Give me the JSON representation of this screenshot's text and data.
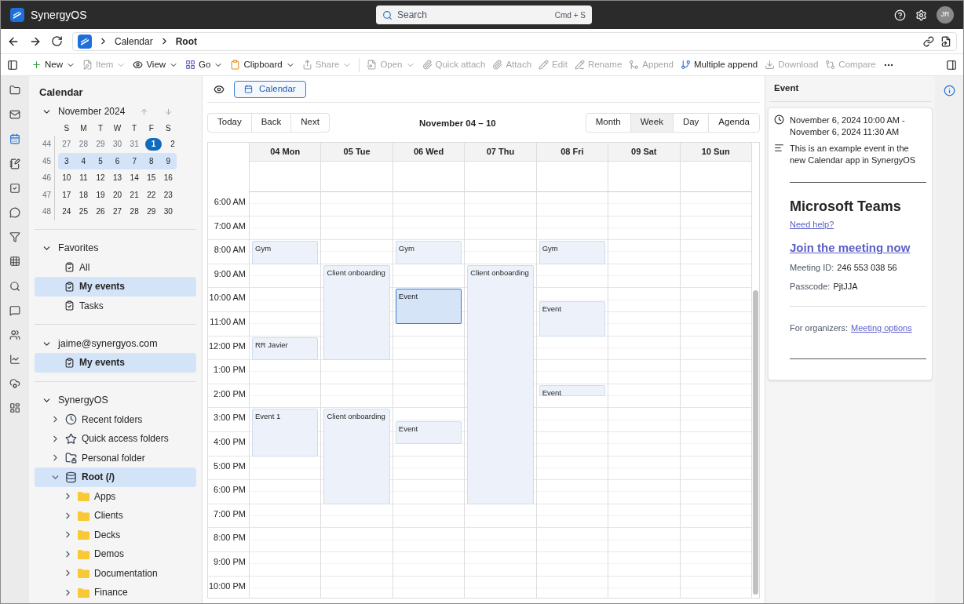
{
  "app": {
    "name": "SynergyOS",
    "search": {
      "placeholder": "Search",
      "shortcut": "Cmd + S"
    },
    "avatar": "JR"
  },
  "breadcrumb": [
    {
      "label": "Calendar",
      "current": false
    },
    {
      "label": "Root",
      "current": true
    }
  ],
  "toolbar": [
    {
      "label": "New",
      "disabled": false,
      "dropdown": true
    },
    {
      "label": "Item",
      "disabled": true,
      "dropdown": true
    },
    {
      "label": "View",
      "disabled": false,
      "dropdown": true
    },
    {
      "label": "Go",
      "disabled": false,
      "dropdown": true
    },
    {
      "label": "Clipboard",
      "disabled": false,
      "dropdown": true
    },
    {
      "label": "Share",
      "disabled": true,
      "dropdown": true
    },
    {
      "label": "Open",
      "disabled": true,
      "dropdown": true
    },
    {
      "label": "Quick attach",
      "disabled": true,
      "dropdown": false
    },
    {
      "label": "Attach",
      "disabled": true,
      "dropdown": false
    },
    {
      "label": "Edit",
      "disabled": true,
      "dropdown": false
    },
    {
      "label": "Rename",
      "disabled": true,
      "dropdown": false
    },
    {
      "label": "Append",
      "disabled": true,
      "dropdown": false
    },
    {
      "label": "Multiple append",
      "disabled": false,
      "dropdown": false
    },
    {
      "label": "Download",
      "disabled": true,
      "dropdown": false
    },
    {
      "label": "Compare",
      "disabled": true,
      "dropdown": false
    }
  ],
  "nav_rail": [
    {
      "selected": false
    },
    {
      "selected": false
    },
    {
      "selected": true
    },
    {
      "selected": false
    },
    {
      "selected": false
    },
    {
      "selected": false
    },
    {
      "selected": false
    },
    {
      "selected": false
    },
    {
      "selected": false
    },
    {
      "selected": false
    },
    {
      "selected": false
    },
    {
      "selected": false
    },
    {
      "selected": false
    },
    {
      "selected": false
    }
  ],
  "sidebar": {
    "title": "Calendar",
    "mini_calendar": {
      "month": "November 2024",
      "expanded": true,
      "weekdays": [
        "S",
        "M",
        "T",
        "W",
        "T",
        "F",
        "S"
      ],
      "weeks": [
        {
          "number": "44",
          "selected": false,
          "days": [
            {
              "d": "27",
              "muted": true,
              "today": false
            },
            {
              "d": "28",
              "muted": true,
              "today": false
            },
            {
              "d": "29",
              "muted": true,
              "today": false
            },
            {
              "d": "30",
              "muted": true,
              "today": false
            },
            {
              "d": "31",
              "muted": true,
              "today": false
            },
            {
              "d": "1",
              "muted": false,
              "today": true
            },
            {
              "d": "2",
              "muted": false,
              "today": false
            }
          ]
        },
        {
          "number": "45",
          "selected": true,
          "days": [
            {
              "d": "3",
              "muted": false,
              "today": false
            },
            {
              "d": "4",
              "muted": false,
              "today": false
            },
            {
              "d": "5",
              "muted": false,
              "today": false
            },
            {
              "d": "6",
              "muted": false,
              "today": false
            },
            {
              "d": "7",
              "muted": false,
              "today": false
            },
            {
              "d": "8",
              "muted": false,
              "today": false
            },
            {
              "d": "9",
              "muted": false,
              "today": false
            }
          ]
        },
        {
          "number": "46",
          "selected": false,
          "days": [
            {
              "d": "10",
              "muted": false,
              "today": false
            },
            {
              "d": "11",
              "muted": false,
              "today": false
            },
            {
              "d": "12",
              "muted": false,
              "today": false
            },
            {
              "d": "13",
              "muted": false,
              "today": false
            },
            {
              "d": "14",
              "muted": false,
              "today": false
            },
            {
              "d": "15",
              "muted": false,
              "today": false
            },
            {
              "d": "16",
              "muted": false,
              "today": false
            }
          ]
        },
        {
          "number": "47",
          "selected": false,
          "days": [
            {
              "d": "17",
              "muted": false,
              "today": false
            },
            {
              "d": "18",
              "muted": false,
              "today": false
            },
            {
              "d": "19",
              "muted": false,
              "today": false
            },
            {
              "d": "20",
              "muted": false,
              "today": false
            },
            {
              "d": "21",
              "muted": false,
              "today": false
            },
            {
              "d": "22",
              "muted": false,
              "today": false
            },
            {
              "d": "23",
              "muted": false,
              "today": false
            }
          ]
        },
        {
          "number": "48",
          "selected": false,
          "days": [
            {
              "d": "24",
              "muted": false,
              "today": false
            },
            {
              "d": "25",
              "muted": false,
              "today": false
            },
            {
              "d": "26",
              "muted": false,
              "today": false
            },
            {
              "d": "27",
              "muted": false,
              "today": false
            },
            {
              "d": "28",
              "muted": false,
              "today": false
            },
            {
              "d": "29",
              "muted": false,
              "today": false
            },
            {
              "d": "30",
              "muted": false,
              "today": false
            }
          ]
        }
      ]
    },
    "sections": [
      {
        "title": "Favorites",
        "expanded": true,
        "items": [
          {
            "label": "All",
            "selected": false
          },
          {
            "label": "My events",
            "selected": true
          },
          {
            "label": "Tasks",
            "selected": false
          }
        ]
      },
      {
        "title": "jaime@synergyos.com",
        "expanded": true,
        "items": [
          {
            "label": "My events",
            "selected": true
          }
        ]
      }
    ],
    "tree": {
      "title": "SynergyOS",
      "expanded": true,
      "items": [
        {
          "label": "Recent folders",
          "kind": "recent",
          "expanded": false,
          "selected": false
        },
        {
          "label": "Quick access folders",
          "kind": "quick",
          "expanded": false,
          "selected": false
        },
        {
          "label": "Personal folder",
          "kind": "personal",
          "expanded": false,
          "selected": false
        },
        {
          "label": "Root (/)",
          "kind": "root",
          "expanded": true,
          "selected": true,
          "children": [
            {
              "label": "Apps",
              "kind": "folder",
              "expanded": false,
              "selected": false
            },
            {
              "label": "Clients",
              "kind": "folder",
              "expanded": false,
              "selected": false
            },
            {
              "label": "Decks",
              "kind": "folder",
              "expanded": false,
              "selected": false
            },
            {
              "label": "Demos",
              "kind": "folder",
              "expanded": false,
              "selected": false
            },
            {
              "label": "Documentation",
              "kind": "folder",
              "expanded": false,
              "selected": false
            },
            {
              "label": "Finance",
              "kind": "folder",
              "expanded": false,
              "selected": false
            }
          ]
        }
      ]
    }
  },
  "main": {
    "tab": {
      "label": "Calendar",
      "selected": true
    },
    "nav_buttons": [
      "Today",
      "Back",
      "Next"
    ],
    "range": "November 04 – 10",
    "views": [
      {
        "label": "Month",
        "selected": false
      },
      {
        "label": "Week",
        "selected": true
      },
      {
        "label": "Day",
        "selected": false
      },
      {
        "label": "Agenda",
        "selected": false
      }
    ],
    "days": [
      {
        "label": "04 Mon",
        "events": [
          {
            "title": "Gym",
            "selected": false
          },
          {
            "title": "RR Javier",
            "selected": false
          },
          {
            "title": "Event 1",
            "selected": false
          }
        ]
      },
      {
        "label": "05 Tue",
        "events": [
          {
            "title": "Client onboarding",
            "selected": false
          },
          {
            "title": "Client onboarding",
            "selected": false
          }
        ]
      },
      {
        "label": "06 Wed",
        "events": [
          {
            "title": "Gym",
            "selected": false
          },
          {
            "title": "Event",
            "selected": true
          },
          {
            "title": "Event",
            "selected": false
          }
        ]
      },
      {
        "label": "07 Thu",
        "events": [
          {
            "title": "Client onboarding",
            "selected": false
          }
        ]
      },
      {
        "label": "08 Fri",
        "events": [
          {
            "title": "Gym",
            "selected": false
          },
          {
            "title": "Event",
            "selected": false
          },
          {
            "title": "Event",
            "selected": false
          }
        ]
      },
      {
        "label": "09 Sat"
      },
      {
        "label": "10 Sun"
      }
    ],
    "hours": [
      "6:00 AM",
      "7:00 AM",
      "8:00 AM",
      "9:00 AM",
      "10:00 AM",
      "11:00 AM",
      "12:00 PM",
      "1:00 PM",
      "2:00 PM",
      "3:00 PM",
      "4:00 PM",
      "5:00 PM",
      "6:00 PM",
      "7:00 PM",
      "8:00 PM",
      "9:00 PM",
      "10:00 PM"
    ]
  },
  "details": {
    "title": "Event",
    "time_lines": [
      "November 6, 2024 10:00 AM -",
      "November 6, 2024 11:30 AM"
    ],
    "description": "This is an example event in the new Calendar app in SynergyOS",
    "meeting": {
      "heading": "Microsoft Teams",
      "help_link": "Need help?",
      "join_link": "Join the meeting now",
      "id_label": "Meeting ID:",
      "id_value": "246 553 038 56",
      "passcode_label": "Passcode:",
      "passcode_value": "PjtJJA",
      "organizers_label": "For organizers:",
      "options_link": "Meeting options"
    }
  }
}
